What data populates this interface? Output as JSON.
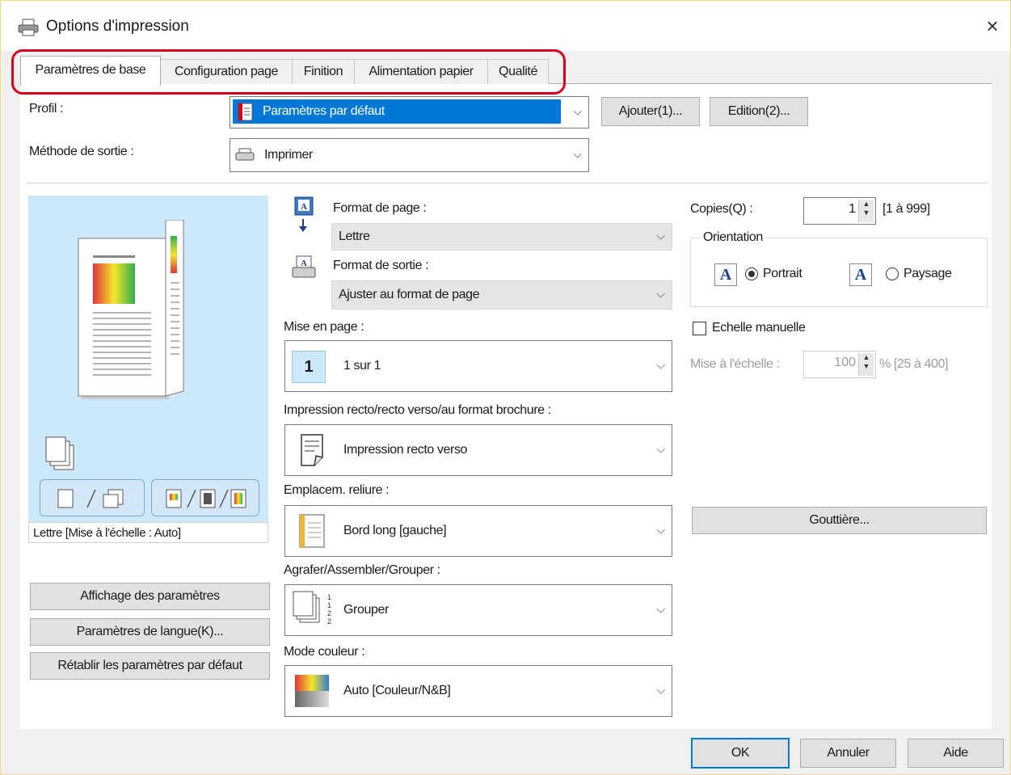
{
  "window": {
    "title": "Options d'impression",
    "close": "×"
  },
  "tabs": [
    {
      "label": "Paramètres de base",
      "active": true
    },
    {
      "label": "Configuration page",
      "active": false
    },
    {
      "label": "Finition",
      "active": false
    },
    {
      "label": "Alimentation papier",
      "active": false
    },
    {
      "label": "Qualité",
      "active": false
    }
  ],
  "profile": {
    "label": "Profil :",
    "value": "Paramètres par défaut",
    "add_button": "Ajouter(1)...",
    "edit_button": "Edition(2)..."
  },
  "output_method": {
    "label": "Méthode de sortie :",
    "value": "Imprimer"
  },
  "preview": {
    "caption": "Lettre [Mise à l'échelle : Auto]"
  },
  "left_buttons": {
    "show_settings": "Affichage des paramètres",
    "language_settings": "Paramètres de langue(K)...",
    "restore_defaults": "Rétablir les paramètres par défaut"
  },
  "page_size": {
    "label": "Format de page :",
    "value": "Lettre"
  },
  "output_size": {
    "label": "Format de sortie :",
    "value": "Ajuster au format de page"
  },
  "layout": {
    "label": "Mise en page :",
    "icon_text": "1",
    "value": "1 sur 1"
  },
  "duplex": {
    "label": "Impression recto/recto verso/au format brochure :",
    "value": "Impression recto verso"
  },
  "binding": {
    "label": "Emplacem. reliure :",
    "value": "Bord long [gauche]"
  },
  "finishing": {
    "label": "Agrafer/Assembler/Grouper :",
    "value": "Grouper"
  },
  "color_mode": {
    "label": "Mode couleur :",
    "value": "Auto [Couleur/N&B]"
  },
  "copies": {
    "label": "Copies(Q) :",
    "value": "1",
    "range": "[1 à 999]"
  },
  "orientation": {
    "group_label": "Orientation",
    "portrait": "Portrait",
    "landscape": "Paysage",
    "selected": "portrait",
    "icon_letter": "A"
  },
  "manual_scale": {
    "label": "Echelle manuelle",
    "checked": false
  },
  "scaling": {
    "label": "Mise à l'échelle :",
    "value": "100",
    "range": "% [25 à 400]"
  },
  "gutter_button": "Gouttière...",
  "footer": {
    "ok": "OK",
    "cancel": "Annuler",
    "help": "Aide"
  },
  "colors": {
    "accent": "#0078d7",
    "highlight_ring": "#d7001f",
    "preview_bg": "#cde8fb"
  }
}
